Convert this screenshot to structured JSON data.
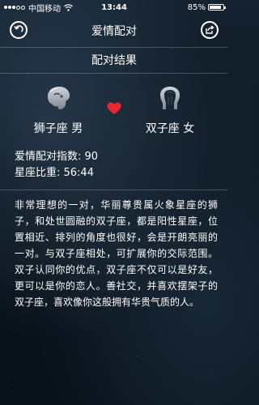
{
  "status_bar": {
    "carrier": "中国移动",
    "time": "13:44",
    "battery": "85%",
    "battery_level": 0.85
  },
  "nav": {
    "title": "爱情配对"
  },
  "result": {
    "section_title": "配对结果",
    "left_sign": "狮子座 男",
    "right_sign": "双子座 女",
    "love_index": "爱情配对指数: 90",
    "ratio": "星座比重: 56:44",
    "description": "非常理想的一对，华丽尊贵属火象星座的狮子，和处世圆融的双子座，都是阳性星座，位置相近、排列的角度也很好，会是开朗亮丽的一对。与双子座相处，可扩展你的交际范围。双子认同你的优点，双子座不仅可以是好友，更可以是你的恋人。善社交，并喜欢摆架子的双子座，喜欢像你这般拥有华贵气质的人。"
  },
  "colors": {
    "heart": "#e8282e",
    "text": "#ffffff"
  },
  "icons": {
    "back": "back-arrow-icon",
    "share": "share-icon",
    "left_sign": "leo-icon",
    "right_sign": "gemini-icon",
    "heart": "heart-icon",
    "wifi": "wifi-icon",
    "battery": "battery-icon"
  }
}
